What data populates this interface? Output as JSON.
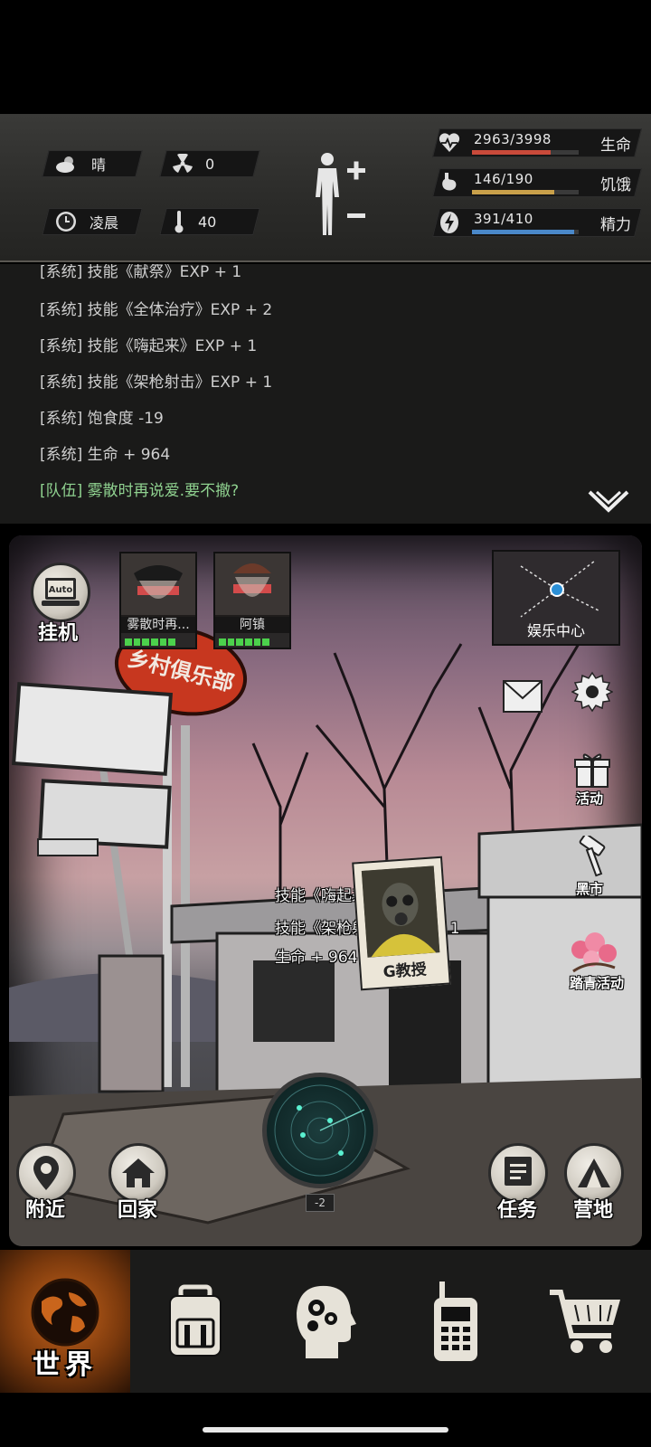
{
  "status": {
    "weather": {
      "icon": "cloud-sun-icon",
      "label": "晴"
    },
    "radiation": {
      "icon": "radiation-icon",
      "value": "0"
    },
    "time_of_day": {
      "icon": "clock-icon",
      "label": "凌晨"
    },
    "temperature": {
      "icon": "thermometer-icon",
      "value": "40"
    },
    "stats": [
      {
        "id": "life",
        "icon": "heart-pulse-icon",
        "value": "2963/3998",
        "label": "生命",
        "fraction": 0.741,
        "color": "#c94a3a"
      },
      {
        "id": "hunger",
        "icon": "stomach-icon",
        "value": "146/190",
        "label": "饥饿",
        "fraction": 0.768,
        "color": "#c9a04a"
      },
      {
        "id": "energy",
        "icon": "lightning-icon",
        "value": "391/410",
        "label": "精力",
        "fraction": 0.954,
        "color": "#4a88c9"
      }
    ]
  },
  "chat": {
    "lines": [
      {
        "text": "[系统] 技能《献祭》EXP + 1",
        "channel": "system"
      },
      {
        "text": "[系统] 技能《全体治疗》EXP + 2",
        "channel": "system"
      },
      {
        "text": "[系统] 技能《嗨起来》EXP + 1",
        "channel": "system"
      },
      {
        "text": "[系统] 技能《架枪射击》EXP + 1",
        "channel": "system"
      },
      {
        "text": "[系统] 饱食度 -19",
        "channel": "system"
      },
      {
        "text": "[系统] 生命 + 964",
        "channel": "system"
      },
      {
        "text": "[队伍] 雾散时再说爱.要不撤?",
        "channel": "team"
      }
    ]
  },
  "scene": {
    "auto_label": "Auto",
    "idle_label": "挂机",
    "party": [
      {
        "name": "雾散时再..."
      },
      {
        "name": "阿镇"
      }
    ],
    "minimap_label": "娱乐中心",
    "sign_text": "乡村俱乐部",
    "side_buttons": {
      "events": "活动",
      "black_market": "黑市",
      "spring_event": "踏青活动"
    },
    "float_lines": [
      "技能《嗨起来》EXP + 1",
      "技能《架枪射击》EXP + 1",
      "生命 + 964"
    ],
    "npc_name": "G教授",
    "radar_level": "-2",
    "nearby_label": "附近",
    "home_label": "回家",
    "quest_label": "任务",
    "camp_label": "营地"
  },
  "nav": {
    "world_label": "世界",
    "items": [
      "globe-icon",
      "backpack-icon",
      "head-gears-icon",
      "walkie-talkie-icon",
      "cart-icon"
    ]
  },
  "colors": {
    "accent_orange": "#c9651c",
    "team_chat": "#8fd18f",
    "hp_green": "#4cd14c"
  }
}
